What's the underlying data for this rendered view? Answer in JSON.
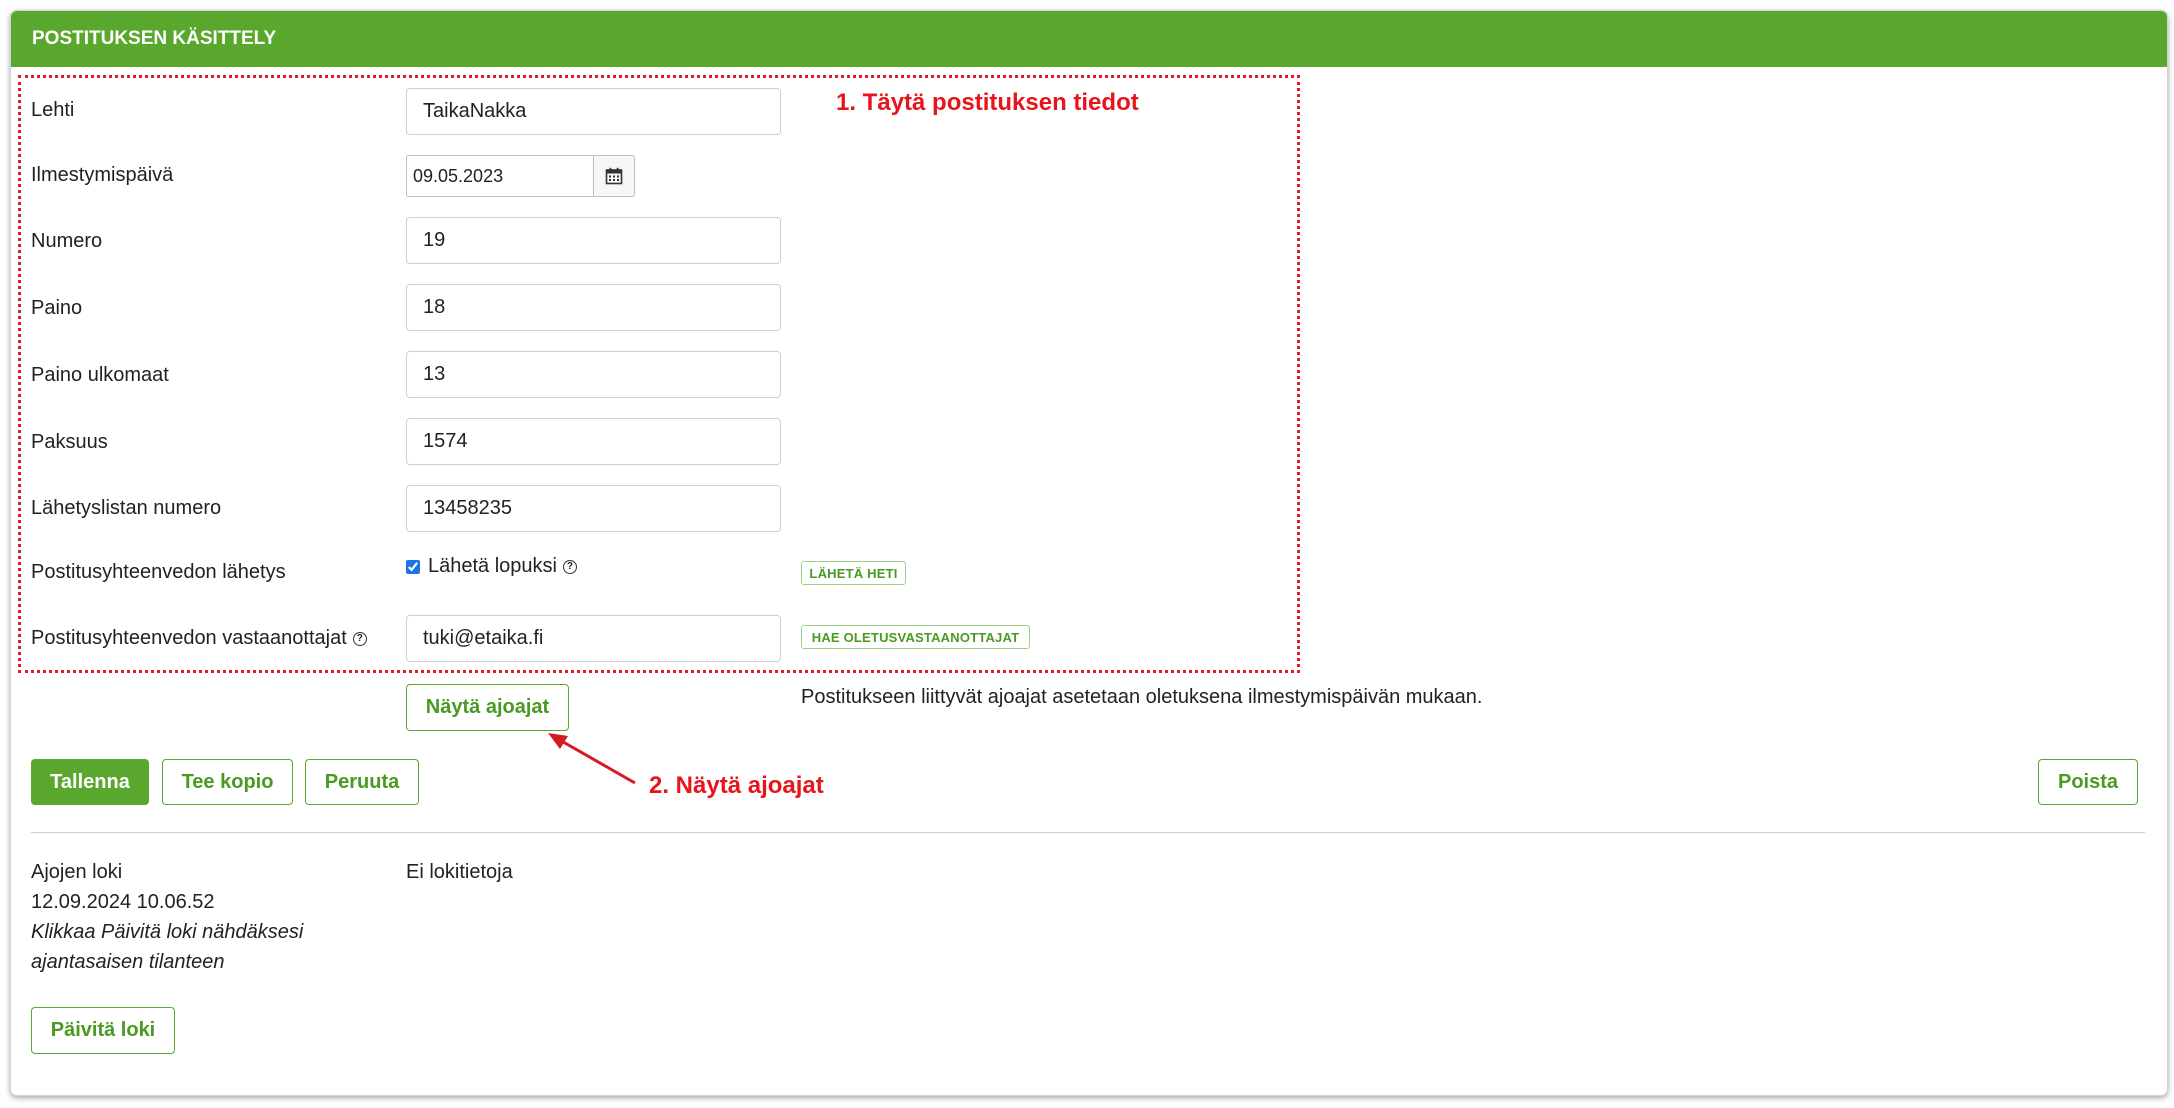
{
  "panel": {
    "title": "POSTITUKSEN KÄSITTELY"
  },
  "form": {
    "lehti": {
      "label": "Lehti",
      "value": "TaikaNakka"
    },
    "ilmestymispaiva": {
      "label": "Ilmestymispäivä",
      "value": "09.05.2023",
      "icon": "calendar-icon"
    },
    "numero": {
      "label": "Numero",
      "value": "19"
    },
    "paino": {
      "label": "Paino",
      "value": "18"
    },
    "paino_ulkomaat": {
      "label": "Paino ulkomaat",
      "value": "13"
    },
    "paksuus": {
      "label": "Paksuus",
      "value": "1574"
    },
    "lahetyslistan_numero": {
      "label": "Lähetyslistan numero",
      "value": "13458235"
    },
    "lahetys": {
      "label": "Postitusyhteenvedon lähetys",
      "checkbox_label": "Lähetä lopuksi",
      "checked": true,
      "help_icon": "?",
      "send_now_button": "LÄHETÄ HETI"
    },
    "vastaanottajat": {
      "label": "Postitusyhteenvedon vastaanottajat",
      "help_icon": "?",
      "value": "tuki@etaika.fi",
      "default_button": "HAE OLETUSVASTAANOTTAJAT"
    }
  },
  "show_runs": {
    "button": "Näytä ajoajat",
    "note": "Postitukseen liittyvät ajoajat asetetaan oletuksena ilmestymispäivän mukaan."
  },
  "actions": {
    "save": "Tallenna",
    "copy": "Tee kopio",
    "cancel": "Peruuta",
    "delete": "Poista"
  },
  "log": {
    "title": "Ajojen loki",
    "timestamp": "12.09.2024 10.06.52",
    "hint_line1": "Klikkaa Päivitä loki nähdäksesi",
    "hint_line2": "ajantasaisen tilanteen",
    "value": "Ei lokitietoja",
    "refresh_button": "Päivitä loki"
  },
  "annotations": {
    "step1": "1. Täytä postituksen tiedot",
    "step2": "2. Näytä ajoajat",
    "color": "#e8141b"
  },
  "colors": {
    "brand": "#5aa72d",
    "annotation": "#e21a2a"
  }
}
